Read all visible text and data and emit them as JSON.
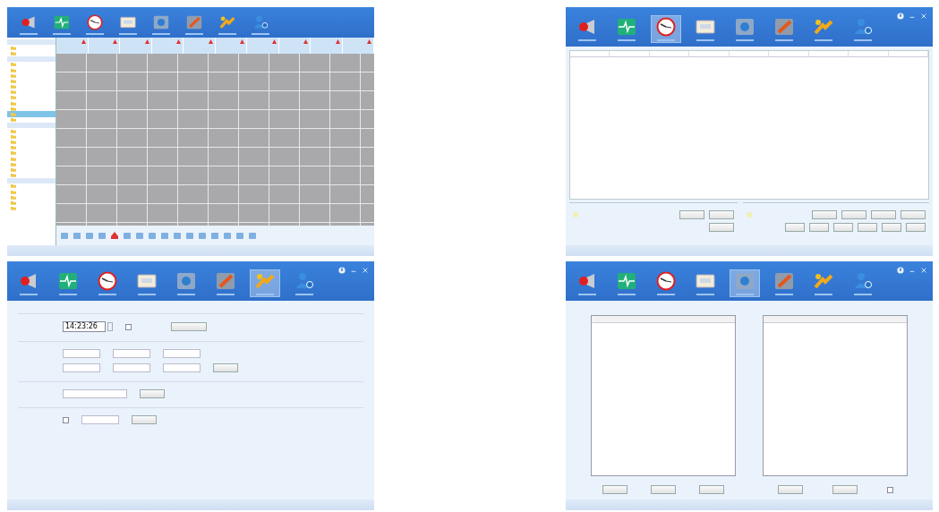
{
  "panels": [
    {
      "kind": "grid",
      "toolbar": [
        {
          "selected": false
        },
        {
          "selected": false
        },
        {
          "selected": false
        },
        {
          "selected": false
        },
        {
          "selected": false
        },
        {
          "selected": false
        },
        {
          "selected": false
        },
        {
          "selected": false
        }
      ],
      "tree": [
        {
          "kind": "group",
          "selected": false
        },
        {
          "kind": "item",
          "selected": false
        },
        {
          "kind": "item",
          "selected": false
        },
        {
          "kind": "group",
          "selected": false
        },
        {
          "kind": "item",
          "selected": false
        },
        {
          "kind": "item",
          "selected": false
        },
        {
          "kind": "item",
          "selected": false
        },
        {
          "kind": "item",
          "selected": false
        },
        {
          "kind": "item",
          "selected": false
        },
        {
          "kind": "item",
          "selected": false
        },
        {
          "kind": "item",
          "selected": false
        },
        {
          "kind": "item",
          "selected": false
        },
        {
          "kind": "item",
          "selected": false
        },
        {
          "kind": "item",
          "selected": true
        },
        {
          "kind": "item",
          "selected": false
        },
        {
          "kind": "group",
          "selected": false
        },
        {
          "kind": "item",
          "selected": false
        },
        {
          "kind": "item",
          "selected": false
        },
        {
          "kind": "item",
          "selected": false
        },
        {
          "kind": "item",
          "selected": false
        },
        {
          "kind": "item",
          "selected": false
        },
        {
          "kind": "item",
          "selected": false
        },
        {
          "kind": "item",
          "selected": false
        },
        {
          "kind": "item",
          "selected": false
        },
        {
          "kind": "item",
          "selected": false
        },
        {
          "kind": "group",
          "selected": false
        },
        {
          "kind": "item",
          "selected": false
        },
        {
          "kind": "item",
          "selected": false
        },
        {
          "kind": "item",
          "selected": false
        },
        {
          "kind": "item",
          "selected": false
        },
        {
          "kind": "item",
          "selected": false
        }
      ]
    },
    {
      "kind": "table",
      "toolbar": [
        {
          "selected": false
        },
        {
          "selected": false
        },
        {
          "selected": true
        },
        {
          "selected": false
        },
        {
          "selected": false
        },
        {
          "selected": false
        },
        {
          "selected": false
        },
        {
          "selected": false
        }
      ]
    },
    {
      "kind": "settings",
      "toolbar": [
        {
          "selected": false
        },
        {
          "selected": false
        },
        {
          "selected": false
        },
        {
          "selected": false
        },
        {
          "selected": false
        },
        {
          "selected": false
        },
        {
          "selected": true
        },
        {
          "selected": false
        }
      ],
      "time_value": "14:23:26",
      "checkboxes": [
        {
          "checked": false
        },
        {
          "checked": false
        }
      ]
    },
    {
      "kind": "lists",
      "toolbar": [
        {
          "selected": false
        },
        {
          "selected": false
        },
        {
          "selected": false
        },
        {
          "selected": false
        },
        {
          "selected": true
        },
        {
          "selected": false
        },
        {
          "selected": false
        },
        {
          "selected": false
        }
      ],
      "checkbox": {
        "checked": false
      }
    }
  ]
}
